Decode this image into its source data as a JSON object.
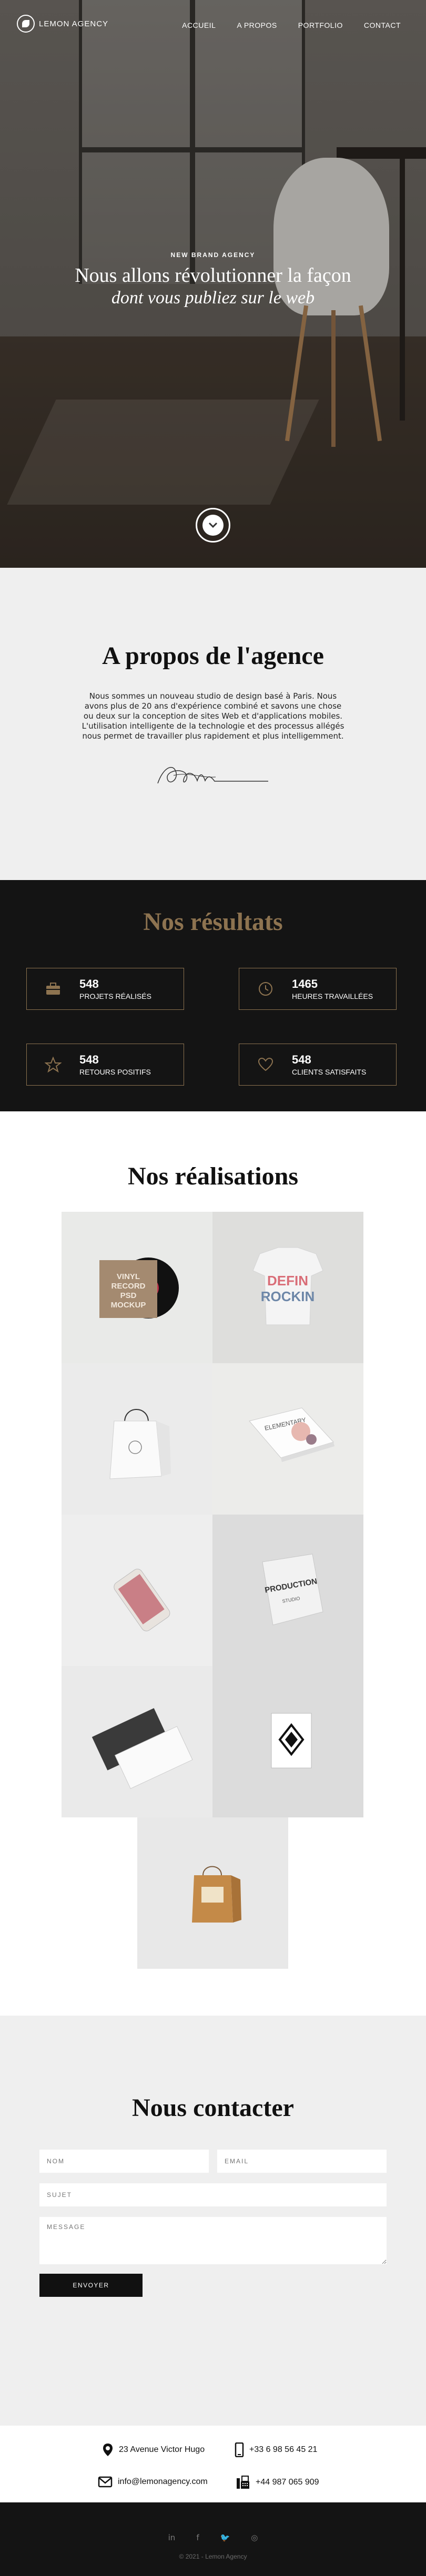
{
  "nav": {
    "logo_text": "LEMON AGENCY",
    "items": [
      {
        "label": "ACCUEIL"
      },
      {
        "label": "A PROPOS"
      },
      {
        "label": "PORTFOLIO"
      },
      {
        "label": "CONTACT"
      }
    ]
  },
  "hero": {
    "kicker": "NEW BRAND AGENCY",
    "title_line1": "Nous allons révolutionner la façon",
    "title_line2": "dont vous publiez sur le web",
    "scroll_icon": "chevron-down-icon"
  },
  "about": {
    "title": "A propos de l'agence",
    "text": "Nous sommes un nouveau studio de design basé à Paris. Nous avons plus de 20 ans d'expérience combiné et savons une chose ou deux sur la conception de sites Web et d'applications mobiles. L'utilisation intelligente de la technologie et des processus allégés nous permet de travailler plus rapidement et plus intelligemment."
  },
  "results": {
    "title": "Nos résultats",
    "accent": "#8d7350",
    "stats": [
      {
        "number": "548",
        "label": "PROJETS RÉALISÉS",
        "icon": "briefcase-icon"
      },
      {
        "number": "1465",
        "label": "HEURES TRAVAILLÉES",
        "icon": "clock-icon"
      },
      {
        "number": "548",
        "label": "RETOURS POSITIFS",
        "icon": "star-icon"
      },
      {
        "number": "548",
        "label": "CLIENTS SATISFAITS",
        "icon": "heart-icon"
      }
    ]
  },
  "portfolio": {
    "title": "Nos réalisations",
    "items": [
      {
        "name": "vinyl-record-mockup",
        "caption": "VINYL RECORD PSD MOCKUP"
      },
      {
        "name": "tshirt-mockup",
        "caption": "DEFIN ROCKIN"
      },
      {
        "name": "shopping-bag-mockup",
        "caption": ""
      },
      {
        "name": "magazine-mockup",
        "caption": ""
      },
      {
        "name": "phone-mockup",
        "caption": ""
      },
      {
        "name": "folded-tshirt-mockup",
        "caption": "PRODUCTION"
      },
      {
        "name": "business-cards-mockup",
        "caption": ""
      },
      {
        "name": "poster-mockup",
        "caption": ""
      },
      {
        "name": "paper-bag-mockup",
        "caption": ""
      }
    ]
  },
  "contact": {
    "title": "Nous contacter",
    "name_placeholder": "NOM",
    "email_placeholder": "EMAIL",
    "subject_placeholder": "SUJET",
    "message_placeholder": "MESSAGE",
    "send_label": "ENVOYER"
  },
  "info": {
    "address": "23 Avenue Victor Hugo",
    "phone": "+33 6 98 56 45 21",
    "email": "info@lemonagency.com",
    "fax": "+44 987 065 909"
  },
  "footer": {
    "socials": [
      {
        "icon": "linkedin-icon",
        "glyph": "in"
      },
      {
        "icon": "facebook-icon",
        "glyph": "f"
      },
      {
        "icon": "twitter-icon",
        "glyph": "🐦"
      },
      {
        "icon": "instagram-icon",
        "glyph": "◎"
      }
    ],
    "copyright": "© 2021 - Lemon Agency"
  }
}
